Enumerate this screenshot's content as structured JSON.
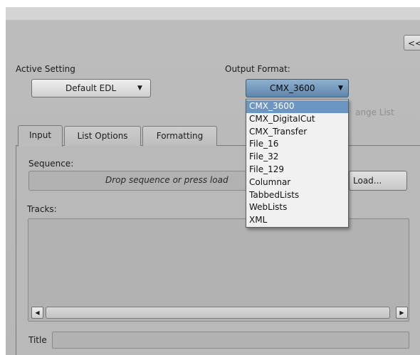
{
  "collapse_button": {
    "label": "<<"
  },
  "active_setting": {
    "label": "Active Setting",
    "value": "Default EDL"
  },
  "output_format": {
    "label": "Output Format:",
    "value": "CMX_3600",
    "options": [
      "CMX_3600",
      "CMX_DigitalCut",
      "CMX_Transfer",
      "File_16",
      "File_32",
      "File_129",
      "Columnar",
      "TabbedLists",
      "WebLists",
      "XML"
    ],
    "selected_index": 0
  },
  "change_list_label": "ange List",
  "tabs": [
    {
      "label": "Input",
      "selected": true
    },
    {
      "label": "List Options",
      "selected": false
    },
    {
      "label": "Formatting",
      "selected": false
    }
  ],
  "sequence": {
    "label": "Sequence:",
    "placeholder": "Drop sequence or press load",
    "load_label": "Load..."
  },
  "tracks": {
    "label": "Tracks:"
  },
  "title": {
    "label": "Title",
    "value": ""
  }
}
